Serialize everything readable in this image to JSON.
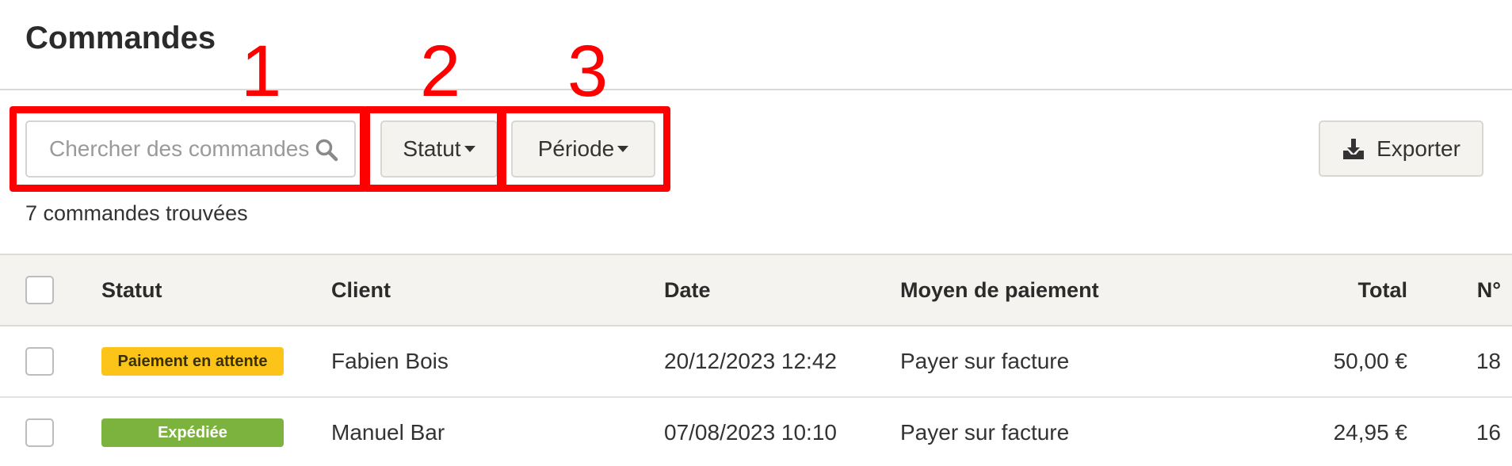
{
  "page": {
    "title": "Commandes"
  },
  "toolbar": {
    "search_placeholder": "Chercher des commandes",
    "status_label": "Statut",
    "period_label": "Période",
    "export_label": "Exporter"
  },
  "callouts": [
    "1",
    "2",
    "3"
  ],
  "results": {
    "count_text": "7 commandes trouvées"
  },
  "table": {
    "headers": {
      "status": "Statut",
      "client": "Client",
      "date": "Date",
      "payment": "Moyen de paiement",
      "total": "Total",
      "number": "N°"
    },
    "rows": [
      {
        "status": "Paiement en attente",
        "status_type": "pending",
        "client": "Fabien Bois",
        "date": "20/12/2023 12:42",
        "payment": "Payer sur facture",
        "total": "50,00 €",
        "number": "18"
      },
      {
        "status": "Expédiée",
        "status_type": "shipped",
        "client": "Manuel Bar",
        "date": "07/08/2023 10:10",
        "payment": "Payer sur facture",
        "total": "24,95 €",
        "number": "16"
      }
    ]
  },
  "colors": {
    "callout": "#ff0000",
    "badge_pending": "#fcc419",
    "badge_shipped": "#7cb33e",
    "header_bg": "#f4f3ef"
  }
}
